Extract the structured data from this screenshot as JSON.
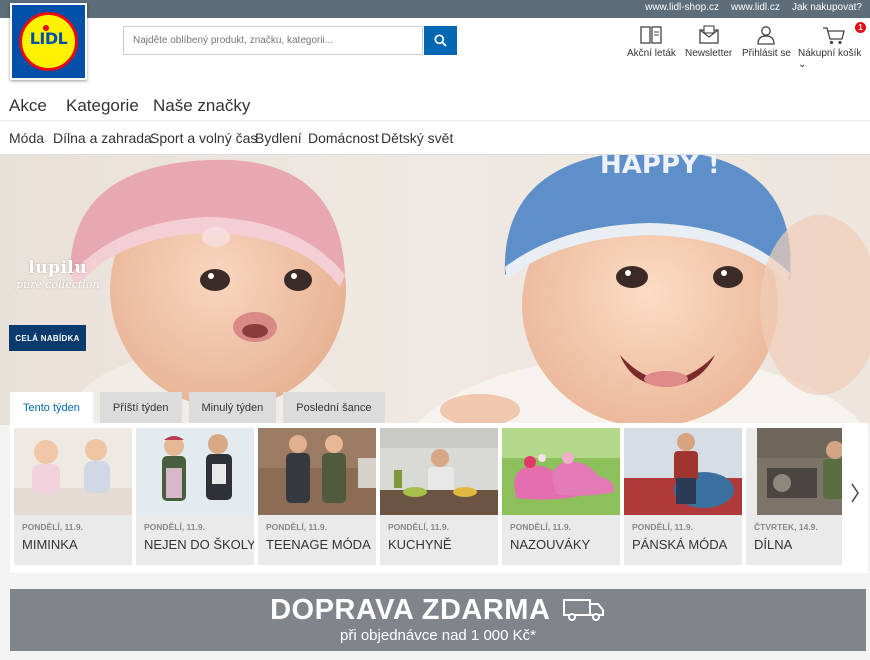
{
  "topbar": {
    "links": [
      "www.lidl-shop.cz",
      "www.lidl.cz",
      "Jak nakupovat?"
    ]
  },
  "logo": {
    "text": "LIDL"
  },
  "search": {
    "placeholder": "Najděte oblíbený produkt, značku, kategorii..."
  },
  "header_icons": [
    {
      "label": "Akční leták",
      "icon": "leaflet-icon"
    },
    {
      "label": "Newsletter",
      "icon": "newsletter-icon"
    },
    {
      "label": "Přihlásit se",
      "icon": "user-icon"
    },
    {
      "label": "Nákupní košík ⌄",
      "icon": "cart-icon",
      "badge": "1"
    }
  ],
  "main_nav": [
    "Akce",
    "Kategorie",
    "Naše značky"
  ],
  "sub_nav": [
    "Móda",
    "Dílna a zahrada",
    "Sport a volný čas",
    "Bydlení",
    "Domácnost",
    "Dětský svět"
  ],
  "hero": {
    "brand_name": "lupilu",
    "brand_tagline": "pure collection",
    "cap_text": "HAPPY !",
    "cta": "CELÁ NABÍDKA"
  },
  "tabs": [
    "Tento týden",
    "Příští týden",
    "Minulý týden",
    "Poslední šance"
  ],
  "active_tab": "Tento týden",
  "offers": [
    {
      "date": "PONDĚLÍ, 11.9.",
      "label": "MIMINKA"
    },
    {
      "date": "PONDĚLÍ, 11.9.",
      "label": "NEJEN DO ŠKOLY"
    },
    {
      "date": "PONDĚLÍ, 11.9.",
      "label": "TEENAGE MÓDA"
    },
    {
      "date": "PONDĚLÍ, 11.9.",
      "label": "KUCHYNĚ"
    },
    {
      "date": "PONDĚLÍ, 11.9.",
      "label": "NAZOUVÁKY"
    },
    {
      "date": "PONDĚLÍ, 11.9.",
      "label": "PÁNSKÁ MÓDA"
    },
    {
      "date": "ČTVRTEK, 14.9.",
      "label": "DÍLNA"
    }
  ],
  "banner": {
    "title": "DOPRAVA ZDARMA",
    "subtitle": "při objednávce nad 1 000 Kč*"
  },
  "colors": {
    "brand_blue": "#0050aa",
    "brand_yellow": "#fff200",
    "brand_red": "#e60a14",
    "accent_blue": "#0068b3",
    "cta_navy": "#0b3a6e",
    "topbar": "#5d6d7a",
    "banner_gray": "#7f858b"
  }
}
